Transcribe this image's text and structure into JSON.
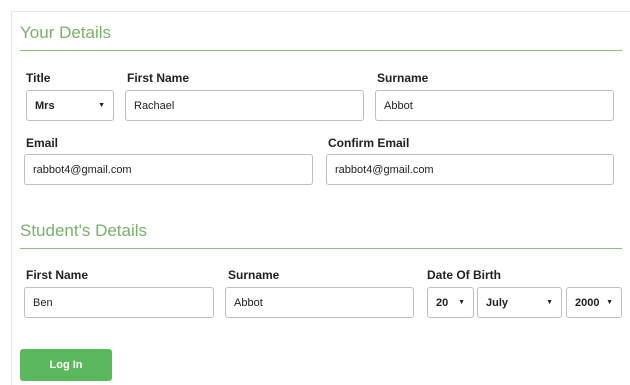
{
  "your_details": {
    "heading": "Your Details",
    "title_label": "Title",
    "title_value": "Mrs",
    "first_name_label": "First Name",
    "first_name_value": "Rachael",
    "surname_label": "Surname",
    "surname_value": "Abbot",
    "email_label": "Email",
    "email_value": "rabbot4@gmail.com",
    "confirm_email_label": "Confirm Email",
    "confirm_email_value": "rabbot4@gmail.com"
  },
  "student_details": {
    "heading": "Student's Details",
    "first_name_label": "First Name",
    "first_name_value": "Ben",
    "surname_label": "Surname",
    "surname_value": "Abbot",
    "dob_label": "Date Of Birth",
    "dob_day": "20",
    "dob_month": "July",
    "dob_year": "2000"
  },
  "actions": {
    "login_label": "Log In"
  },
  "colors": {
    "accent": "#79b36a",
    "button": "#5cb85c",
    "rule": "#87c27a"
  }
}
